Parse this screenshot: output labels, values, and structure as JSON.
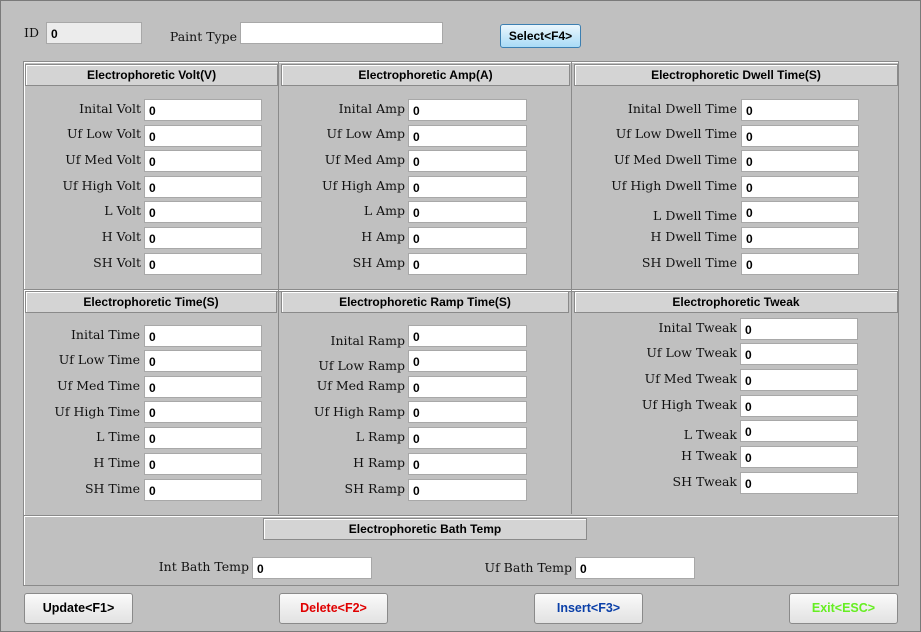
{
  "header": {
    "id_label": "ID",
    "id_value": "0",
    "paint_type_label": "Paint Type",
    "paint_type_value": "",
    "select_button": "Select<F4>"
  },
  "volt": {
    "title": "Electrophoretic Volt(V)",
    "rows": [
      {
        "label": "Inital Volt",
        "value": "0"
      },
      {
        "label": "Uf Low Volt",
        "value": "0"
      },
      {
        "label": "Uf Med Volt",
        "value": "0"
      },
      {
        "label": "Uf High Volt",
        "value": "0"
      },
      {
        "label": "L Volt",
        "value": "0"
      },
      {
        "label": "H Volt",
        "value": "0"
      },
      {
        "label": "SH Volt",
        "value": "0"
      }
    ]
  },
  "amp": {
    "title": "Electrophoretic Amp(A)",
    "rows": [
      {
        "label": "Inital Amp",
        "value": "0"
      },
      {
        "label": "Uf Low Amp",
        "value": "0"
      },
      {
        "label": "Uf Med Amp",
        "value": "0"
      },
      {
        "label": "Uf High Amp",
        "value": "0"
      },
      {
        "label": "L Amp",
        "value": "0"
      },
      {
        "label": "H Amp",
        "value": "0"
      },
      {
        "label": "SH Amp",
        "value": "0"
      }
    ]
  },
  "dwell": {
    "title": "Electrophoretic Dwell Time(S)",
    "rows": [
      {
        "label": "Inital Dwell Time",
        "value": "0"
      },
      {
        "label": "Uf Low Dwell Time",
        "value": "0"
      },
      {
        "label": "Uf Med Dwell Time",
        "value": "0"
      },
      {
        "label": "Uf High Dwell Time",
        "value": "0"
      },
      {
        "label": "L Dwell Time",
        "value": "0"
      },
      {
        "label": "H Dwell Time",
        "value": "0"
      },
      {
        "label": "SH Dwell Time",
        "value": "0"
      }
    ]
  },
  "time": {
    "title": "Electrophoretic Time(S)",
    "rows": [
      {
        "label": "Inital Time",
        "value": "0"
      },
      {
        "label": "Uf Low Time",
        "value": "0"
      },
      {
        "label": "Uf Med Time",
        "value": "0"
      },
      {
        "label": "Uf High Time",
        "value": "0"
      },
      {
        "label": "L Time",
        "value": "0"
      },
      {
        "label": "H Time",
        "value": "0"
      },
      {
        "label": "SH Time",
        "value": "0"
      }
    ]
  },
  "ramp": {
    "title": "Electrophoretic Ramp Time(S)",
    "rows": [
      {
        "label": "Inital Ramp",
        "value": "0"
      },
      {
        "label": "Uf Low Ramp",
        "value": "0"
      },
      {
        "label": "Uf Med Ramp",
        "value": "0"
      },
      {
        "label": "Uf High Ramp",
        "value": "0"
      },
      {
        "label": "L Ramp",
        "value": "0"
      },
      {
        "label": "H Ramp",
        "value": "0"
      },
      {
        "label": "SH Ramp",
        "value": "0"
      }
    ]
  },
  "tweak": {
    "title": "Electrophoretic Tweak",
    "rows": [
      {
        "label": "Inital Tweak",
        "value": "0"
      },
      {
        "label": "Uf Low Tweak",
        "value": "0"
      },
      {
        "label": "Uf Med Tweak",
        "value": "0"
      },
      {
        "label": "Uf High Tweak",
        "value": "0"
      },
      {
        "label": "L Tweak",
        "value": "0"
      },
      {
        "label": "H Tweak",
        "value": "0"
      },
      {
        "label": "SH Tweak",
        "value": "0"
      }
    ]
  },
  "bath": {
    "title": "Electrophoretic Bath Temp",
    "int_label": "Int Bath Temp",
    "int_value": "0",
    "uf_label": "Uf Bath Temp",
    "uf_value": "0"
  },
  "buttons": {
    "update": {
      "label": "Update<F1>",
      "color": "#000000"
    },
    "delete": {
      "label": "Delete<F2>",
      "color": "#e00000"
    },
    "insert": {
      "label": "Insert<F3>",
      "color": "#0a3fa8"
    },
    "exit": {
      "label": "Exit<ESC>",
      "color": "#66ee22"
    }
  }
}
